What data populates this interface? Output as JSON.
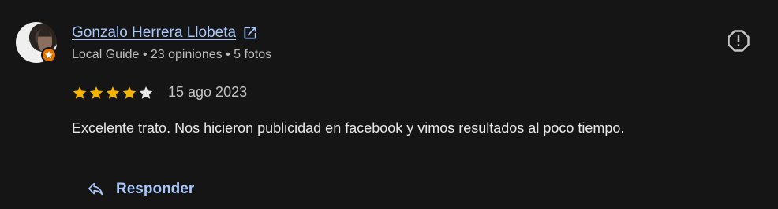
{
  "reviewer": {
    "name": "Gonzalo Herrera Llobeta",
    "meta": "Local Guide • 23 opiniones • 5 fotos",
    "badge_icon": "local-guide-star-icon",
    "badge_color": "#e37400"
  },
  "review": {
    "rating": 4,
    "max_rating": 5,
    "date": "15 ago 2023",
    "text": "Excelente trato. Nos hicieron publicidad en facebook y vimos resultados al poco tiempo."
  },
  "actions": {
    "reply_label": "Responder",
    "report_icon": "report-icon",
    "external_link_icon": "open-in-new-icon"
  },
  "colors": {
    "link": "#a8c7fa",
    "star_filled": "#f4b400",
    "star_empty": "#e8e8e8",
    "background": "#151515"
  }
}
